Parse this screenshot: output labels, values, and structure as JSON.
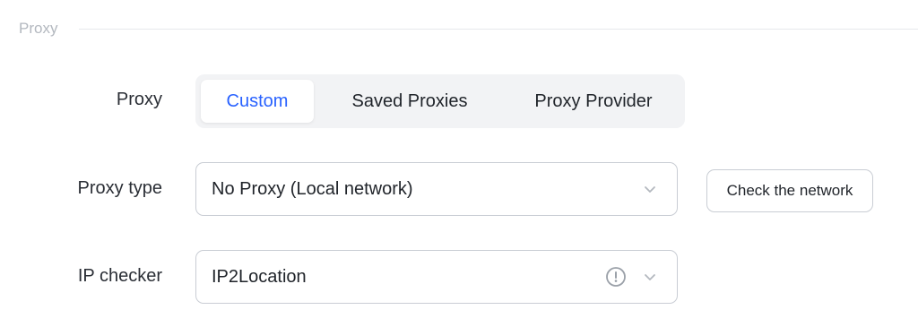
{
  "section": {
    "title": "Proxy"
  },
  "proxy_row": {
    "label": "Proxy",
    "tabs": [
      {
        "label": "Custom",
        "active": true
      },
      {
        "label": "Saved Proxies",
        "active": false
      },
      {
        "label": "Proxy Provider",
        "active": false
      }
    ]
  },
  "proxy_type_row": {
    "label": "Proxy type",
    "selected": "No Proxy (Local network)",
    "check_button_label": "Check the network"
  },
  "ip_checker_row": {
    "label": "IP checker",
    "selected": "IP2Location"
  },
  "colors": {
    "accent": "#2962ff",
    "segmented_bg": "#f2f3f5",
    "border": "#c9cdd4",
    "muted_text": "#b3b8bf"
  },
  "icons": {
    "chevron": "chevron-down-icon",
    "info": "info-circle-icon"
  }
}
